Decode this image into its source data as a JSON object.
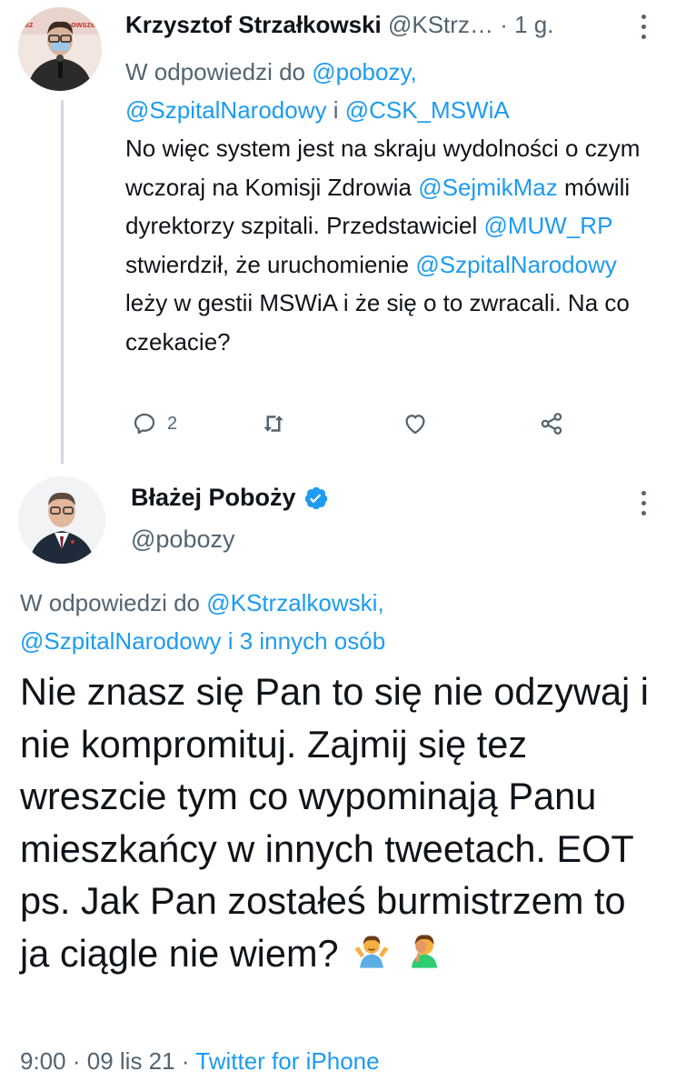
{
  "reply_tweet": {
    "author_name": "Krzysztof Strzałkowski",
    "handle": "@KStrz…",
    "separator": "·",
    "time": "1 g.",
    "replying_prefix": "W odpowiedzi do",
    "replying_handle_1": "@pobozy,",
    "replying_handle_2": "@SzpitalNarodowy",
    "replying_conj": "i",
    "replying_handle_3": "@CSK_MSWiA",
    "body": {
      "p1": "No więc system jest na skraju wydolności o czym wczoraj na Komisji Zdrowia",
      "m1": "@SejmikMaz",
      "p2": "mówili dyrektorzy szpitali. Przedstawiciel",
      "m2": "@MUW_RP",
      "p3": "stwierdził, że uruchomienie",
      "m3": "@SzpitalNarodowy",
      "p4": "leży w gestii MSWiA i że się o to zwracali. Na co czekacie?"
    },
    "reply_count": "2",
    "icons": [
      "reply-icon",
      "retweet-icon",
      "like-icon",
      "share-icon",
      "more-icon"
    ]
  },
  "main_tweet": {
    "author_name": "Błażej Poboży",
    "handle": "@pobozy",
    "replying_prefix": "W odpowiedzi do",
    "replying_handle_1": "@KStrzalkowski,",
    "replying_handle_2": "@SzpitalNarodowy",
    "replying_suffix": "i 3 innych osób",
    "body": "Nie znasz się Pan to się nie odzywaj i nie kompromituj. Zajmij się tez wreszcie tym co wypominają Panu mieszkańcy w innych tweetach. EOT ps. Jak Pan zostałeś burmistrzem to ja ciągle nie wiem?",
    "emojis": [
      "person-shrugging-emoji",
      "person-facepalming-emoji"
    ],
    "time": "9:00",
    "sep": "·",
    "date": "09 lis 21",
    "source": "Twitter for iPhone",
    "icons": [
      "verified-badge-icon",
      "more-icon"
    ]
  },
  "colors": {
    "link": "#1d9bf0",
    "muted": "#536471",
    "text": "#0f1419",
    "line": "#cfd9de"
  }
}
